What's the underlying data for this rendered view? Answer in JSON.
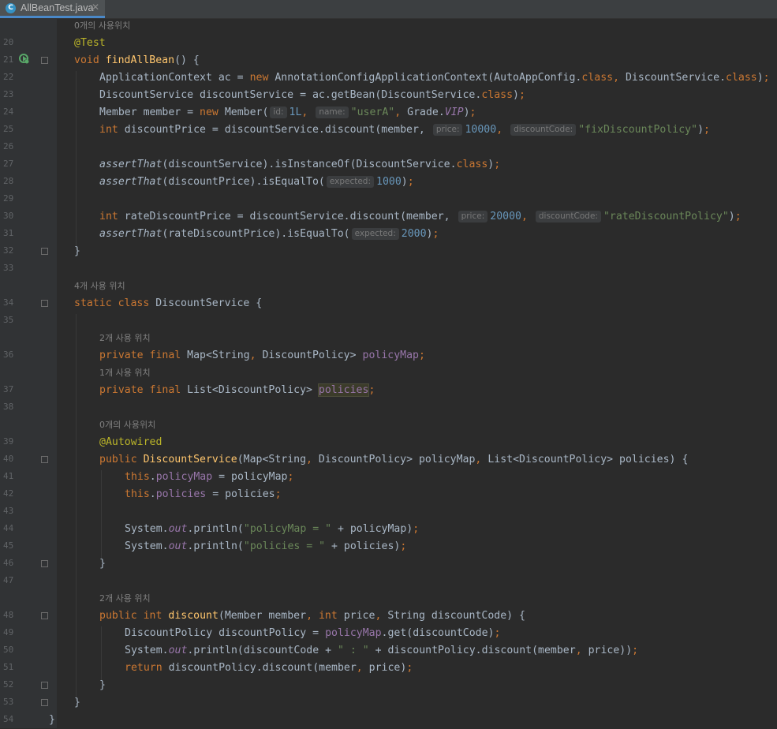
{
  "tab": {
    "icon": "java-class-icon",
    "label": "AllBeanTest.java",
    "close": "✕"
  },
  "hints": {
    "h20": "0개의 사용위치",
    "h34": "4개 사용 위치",
    "h36": "2개 사용 위치",
    "h37": "1개 사용 위치",
    "h39": "0개의 사용위치",
    "h48": "2개 사용 위치"
  },
  "params": {
    "id": "id:",
    "name": "name:",
    "price": "price:",
    "discountCode": "discountCode:",
    "expected": "expected:"
  },
  "lines": {
    "n20": "20",
    "n21": "21",
    "n22": "22",
    "n23": "23",
    "n24": "24",
    "n25": "25",
    "n26": "26",
    "n27": "27",
    "n28": "28",
    "n29": "29",
    "n30": "30",
    "n31": "31",
    "n32": "32",
    "n33": "33",
    "n34": "34",
    "n35": "35",
    "n36": "36",
    "n37": "37",
    "n38": "38",
    "n39": "39",
    "n40": "40",
    "n41": "41",
    "n42": "42",
    "n43": "43",
    "n44": "44",
    "n45": "45",
    "n46": "46",
    "n47": "47",
    "n48": "48",
    "n49": "49",
    "n50": "50",
    "n51": "51",
    "n52": "52",
    "n53": "53",
    "n54": "54"
  },
  "code": {
    "l20": {
      "ann": "@Test"
    },
    "l21": {
      "kw": "void",
      "fn": "findAllBean",
      "rest": "() {"
    },
    "l22": {
      "a": "ApplicationContext ac = ",
      "kw": "new",
      "b": " AnnotationConfigApplicationContext(AutoAppConfig.",
      "cls1": "class",
      "c": ", DiscountService.",
      "cls2": "class",
      "d": ");"
    },
    "l23": {
      "a": "DiscountService discountService = ac.getBean(DiscountService.",
      "cls": "class",
      "b": ");"
    },
    "l24": {
      "a": "Member member = ",
      "kw": "new",
      "b": " Member(",
      "n1": "1L",
      "c": ", ",
      "s": "\"userA\"",
      "d": ", Grade.",
      "vip": "VIP",
      "e": ");"
    },
    "l25": {
      "kw": "int",
      "a": " discountPrice = discountService.discount(member, ",
      "n": "10000",
      "c": ", ",
      "s": "\"fixDiscountPolicy\"",
      "e": ");"
    },
    "l27": {
      "it": "assertThat",
      "a": "(discountService).isInstanceOf(DiscountService.",
      "cls": "class",
      "b": ");"
    },
    "l28": {
      "it": "assertThat",
      "a": "(discountPrice).isEqualTo(",
      "n": "1000",
      "b": ");"
    },
    "l30": {
      "kw": "int",
      "a": " rateDiscountPrice = discountService.discount(member, ",
      "n": "20000",
      "c": ", ",
      "s": "\"rateDiscountPolicy\"",
      "e": ");"
    },
    "l31": {
      "it": "assertThat",
      "a": "(rateDiscountPrice).isEqualTo(",
      "n": "2000",
      "b": ");"
    },
    "l32": {
      "a": "}"
    },
    "l34": {
      "kw1": "static",
      "kw2": "class",
      "a": " DiscountService {"
    },
    "l36": {
      "kw1": "private",
      "kw2": "final",
      "a": " Map<String, DiscountPolicy> ",
      "fld": "policyMap",
      "b": ";"
    },
    "l37": {
      "kw1": "private",
      "kw2": "final",
      "a": " List<DiscountPolicy> ",
      "fld": "policies",
      "b": ";"
    },
    "l39": {
      "ann": "@Autowired"
    },
    "l40": {
      "kw": "public",
      "fn": "DiscountService",
      "a": "(Map<String, DiscountPolicy> policyMap, List<DiscountPolicy> policies) {"
    },
    "l41": {
      "kw": "this",
      "dot": ".",
      "fld": "policyMap",
      "a": " = policyMap;"
    },
    "l42": {
      "kw": "this",
      "dot": ".",
      "fld": "policies",
      "a": " = policies;"
    },
    "l44": {
      "a": "System.",
      "sf": "out",
      "b": ".println(",
      "s": "\"policyMap = \"",
      "c": " + policyMap);"
    },
    "l45": {
      "a": "System.",
      "sf": "out",
      "b": ".println(",
      "s": "\"policies = \"",
      "c": " + policies);"
    },
    "l46": {
      "a": "}"
    },
    "l48": {
      "kw1": "public",
      "kw2": "int",
      "fn": "discount",
      "a": "(Member member, ",
      "kw3": "int",
      "b": " price, String discountCode) {"
    },
    "l49": {
      "a": "DiscountPolicy discountPolicy = ",
      "fld": "policyMap",
      "b": ".get(discountCode);"
    },
    "l50": {
      "a": "System.",
      "sf": "out",
      "b": ".println(discountCode + ",
      "s": "\" : \"",
      "c": " + discountPolicy.discount(member, price));"
    },
    "l51": {
      "kw": "return",
      "a": " discountPolicy.discount(member, price);"
    },
    "l52": {
      "a": "}"
    },
    "l53": {
      "a": "}"
    },
    "l54": {
      "a": "}"
    }
  },
  "colors": {
    "background": "#2b2b2b",
    "gutter": "#313335",
    "keyword": "#cc7832",
    "annotation": "#bbb529",
    "method": "#ffc66d",
    "field": "#9876aa",
    "string": "#6a8759",
    "number": "#6897bb",
    "text": "#a9b7c6"
  }
}
